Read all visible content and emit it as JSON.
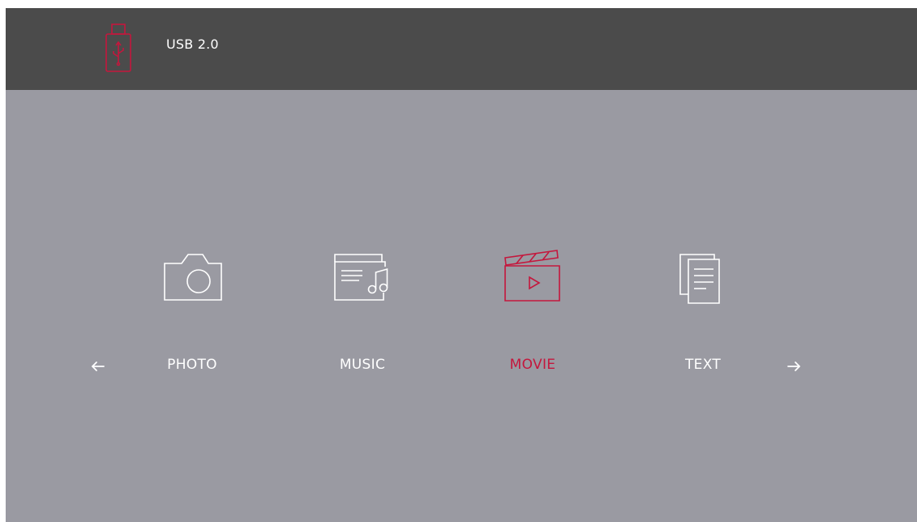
{
  "header": {
    "usb_icon": "usb-drive-icon",
    "title": "USB 2.0"
  },
  "menu": {
    "selected": "MOVIE",
    "items": [
      {
        "label": "PHOTO",
        "icon": "camera-icon"
      },
      {
        "label": "MUSIC",
        "icon": "music-list-icon"
      },
      {
        "label": "MOVIE",
        "icon": "clapperboard-icon"
      },
      {
        "label": "TEXT",
        "icon": "document-icon"
      }
    ],
    "prev_icon": "arrow-left-icon",
    "next_icon": "arrow-right-icon"
  },
  "colors": {
    "accent": "#c4173d",
    "header_bg": "#4b4b4b",
    "screen_bg": "#9a9aa2",
    "text": "#ffffff"
  }
}
